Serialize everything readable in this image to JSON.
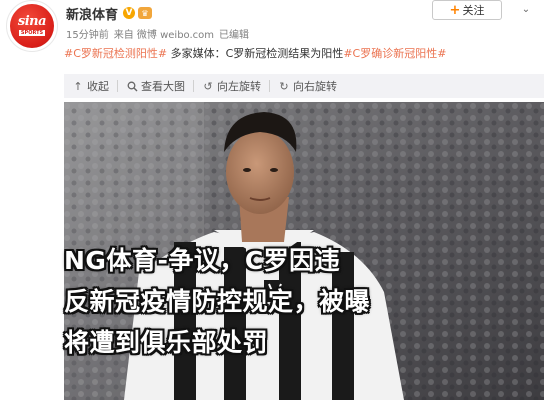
{
  "account": {
    "name": "新浪体育",
    "avatar_brand": "sina",
    "avatar_sub": "SPORTS",
    "verified_label": "V",
    "time": "15分钟前",
    "source": "来自 微博 weibo.com",
    "edited": "已编辑",
    "follow_label": "关注"
  },
  "post": {
    "hashtag1": "#C罗新冠检测阳性#",
    "text": " 多家媒体：C罗新冠检测结果为阳性",
    "hashtag2": "#C罗确诊新冠阳性#"
  },
  "toolbar": {
    "collapse_label": "收起",
    "view_large_label": "查看大图",
    "rotate_left_label": "向左旋转",
    "rotate_right_label": "向右旋转"
  },
  "image_caption": {
    "line1": "NG体育-争议，C罗因违",
    "line2": "反新冠疫情防控规定，被曝",
    "line3": "将遭到俱乐部处罚"
  },
  "colors": {
    "hashtag": "#eb7350",
    "accent_orange": "#ff8200",
    "brand_red": "#d91e18"
  }
}
